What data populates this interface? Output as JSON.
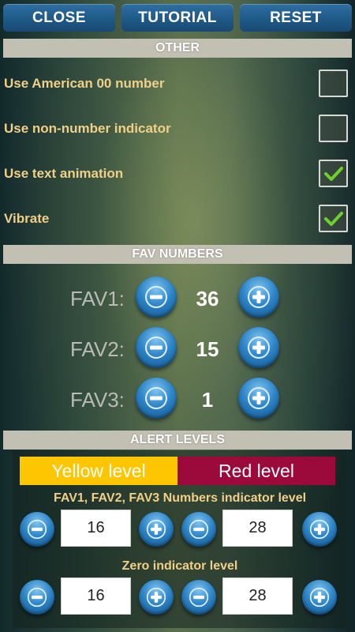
{
  "toolbar": {
    "close_label": "CLOSE",
    "tutorial_label": "TUTORIAL",
    "reset_label": "RESET"
  },
  "other": {
    "header": "OTHER",
    "options": [
      {
        "label": "Use American 00 number",
        "checked": false
      },
      {
        "label": "Use non-number indicator",
        "checked": false
      },
      {
        "label": "Use text animation",
        "checked": true
      },
      {
        "label": "Vibrate",
        "checked": true
      }
    ]
  },
  "fav_numbers": {
    "header": "FAV NUMBERS",
    "items": [
      {
        "label": "FAV1:",
        "value": "36"
      },
      {
        "label": "FAV2:",
        "value": "15"
      },
      {
        "label": "FAV3:",
        "value": "1"
      }
    ]
  },
  "alert_levels": {
    "header": "ALERT LEVELS",
    "yellow_label": "Yellow level",
    "red_label": "Red level",
    "fav_indicator": {
      "title": "FAV1, FAV2, FAV3 Numbers indicator level",
      "yellow_value": "16",
      "red_value": "28"
    },
    "zero_indicator": {
      "title": "Zero indicator level",
      "yellow_value": "16",
      "red_value": "28"
    }
  },
  "colors": {
    "label_text": "#f0d088",
    "yellow": "#fdc600",
    "red": "#9c0a3c",
    "check": "#6fcf2e"
  },
  "icons": {
    "minus": "minus-icon",
    "plus": "plus-icon",
    "check": "checkmark-icon"
  }
}
